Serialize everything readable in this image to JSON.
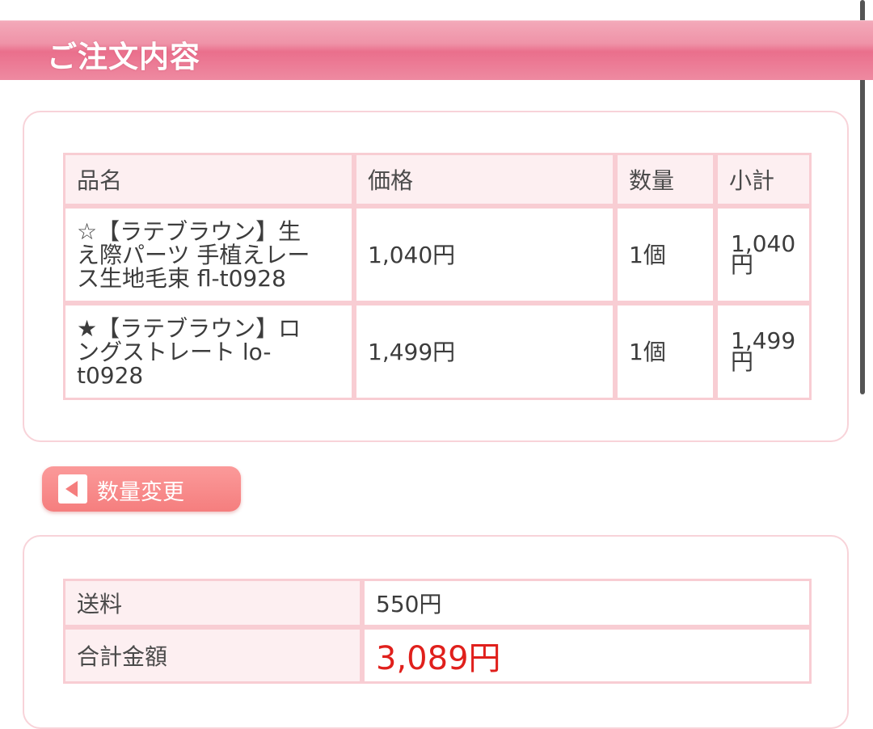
{
  "header": {
    "title": "ご注文内容"
  },
  "items_table": {
    "columns": [
      "品名",
      "価格",
      "数量",
      "小計"
    ],
    "rows": [
      {
        "name_line1": "☆【ラテブラウン】生",
        "name_line2": "え際パーツ 手植えレー",
        "name_line3": "ス生地毛束 fl-t0928",
        "price": "1,040円",
        "qty": "1個",
        "subtotal_line1": "1,040",
        "subtotal_line2": "円"
      },
      {
        "name_line1": "★【ラテブラウン】ロ",
        "name_line2": "ングストレート lo-",
        "name_line3": "t0928",
        "price": "1,499円",
        "qty": "1個",
        "subtotal_line1": "1,499",
        "subtotal_line2": "円"
      }
    ]
  },
  "change_qty_button": {
    "label": "数量変更",
    "icon": "triangle-left-icon"
  },
  "totals_table": {
    "shipping_label": "送料",
    "shipping_value": "550円",
    "total_label": "合計金額",
    "total_value": "3,089円"
  },
  "colors": {
    "header_pink": "#ea6f8c",
    "border_pink": "#f8cdd3",
    "button_pink": "#f57e7e",
    "total_red": "#e0201c"
  }
}
